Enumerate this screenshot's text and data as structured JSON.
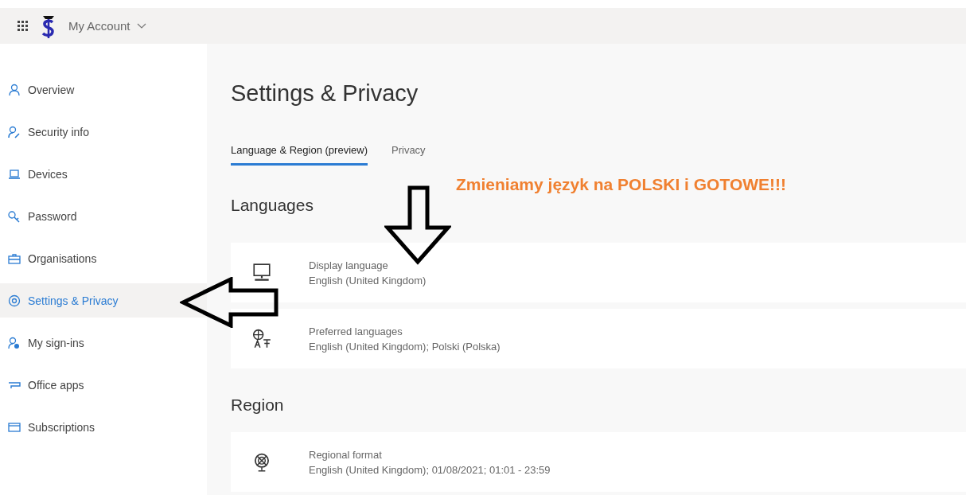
{
  "header": {
    "app_title": "My Account"
  },
  "sidebar": {
    "items": [
      {
        "label": "Overview",
        "selected": false
      },
      {
        "label": "Security info",
        "selected": false
      },
      {
        "label": "Devices",
        "selected": false
      },
      {
        "label": "Password",
        "selected": false
      },
      {
        "label": "Organisations",
        "selected": false
      },
      {
        "label": "Settings & Privacy",
        "selected": true
      },
      {
        "label": "My sign-ins",
        "selected": false
      },
      {
        "label": "Office apps",
        "selected": false
      },
      {
        "label": "Subscriptions",
        "selected": false
      }
    ]
  },
  "main": {
    "title": "Settings & Privacy",
    "tabs": [
      {
        "label": "Language & Region (preview)",
        "selected": true
      },
      {
        "label": "Privacy",
        "selected": false
      }
    ],
    "annotation": "Zmieniamy język na POLSKI i GOTOWE!!!",
    "sections": [
      {
        "heading": "Languages",
        "cards": [
          {
            "title": "Display language",
            "value": "English (United Kingdom)"
          },
          {
            "title": "Preferred languages",
            "value": "English (United Kingdom); Polski (Polska)"
          }
        ]
      },
      {
        "heading": "Region",
        "cards": [
          {
            "title": "Regional format",
            "value": "English (United Kingdom); 01/08/2021; 01:01 - 23:59"
          }
        ]
      }
    ]
  }
}
